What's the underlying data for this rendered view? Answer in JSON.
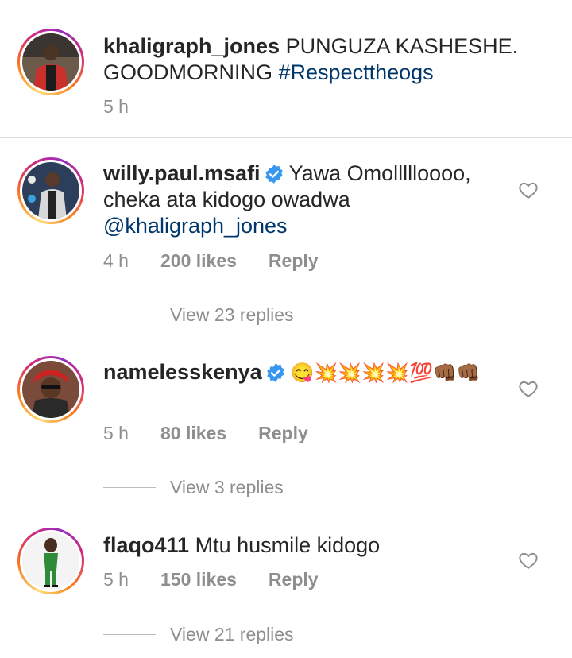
{
  "caption": {
    "username": "khaligraph_jones",
    "text": "PUNGUZA KASHESHE. GOODMORNING",
    "hashtag": "#Respecttheogs",
    "time": "5 h"
  },
  "comments": [
    {
      "username": "willy.paul.msafi",
      "verified": true,
      "text": "Yawa Omollllloooo, cheka ata kidogo owadwa",
      "mention": "@khaligraph_jones",
      "time": "4 h",
      "likes": "200 likes",
      "reply": "Reply",
      "view_replies": "View 23 replies"
    },
    {
      "username": "namelesskenya",
      "verified": true,
      "text": "😋💥💥💥💥💯👊🏾👊🏾",
      "time": "5 h",
      "likes": "80 likes",
      "reply": "Reply",
      "view_replies": "View 3 replies"
    },
    {
      "username": "flaqo411",
      "verified": false,
      "text": "Mtu husmile kidogo",
      "time": "5 h",
      "likes": "150 likes",
      "reply": "Reply",
      "view_replies": "View 21 replies"
    }
  ],
  "colors": {
    "link": "#00376b",
    "meta": "#8e8e8e",
    "verified": "#3897f0"
  },
  "icons": [
    "heart-outline-icon",
    "verified-badge-icon"
  ]
}
